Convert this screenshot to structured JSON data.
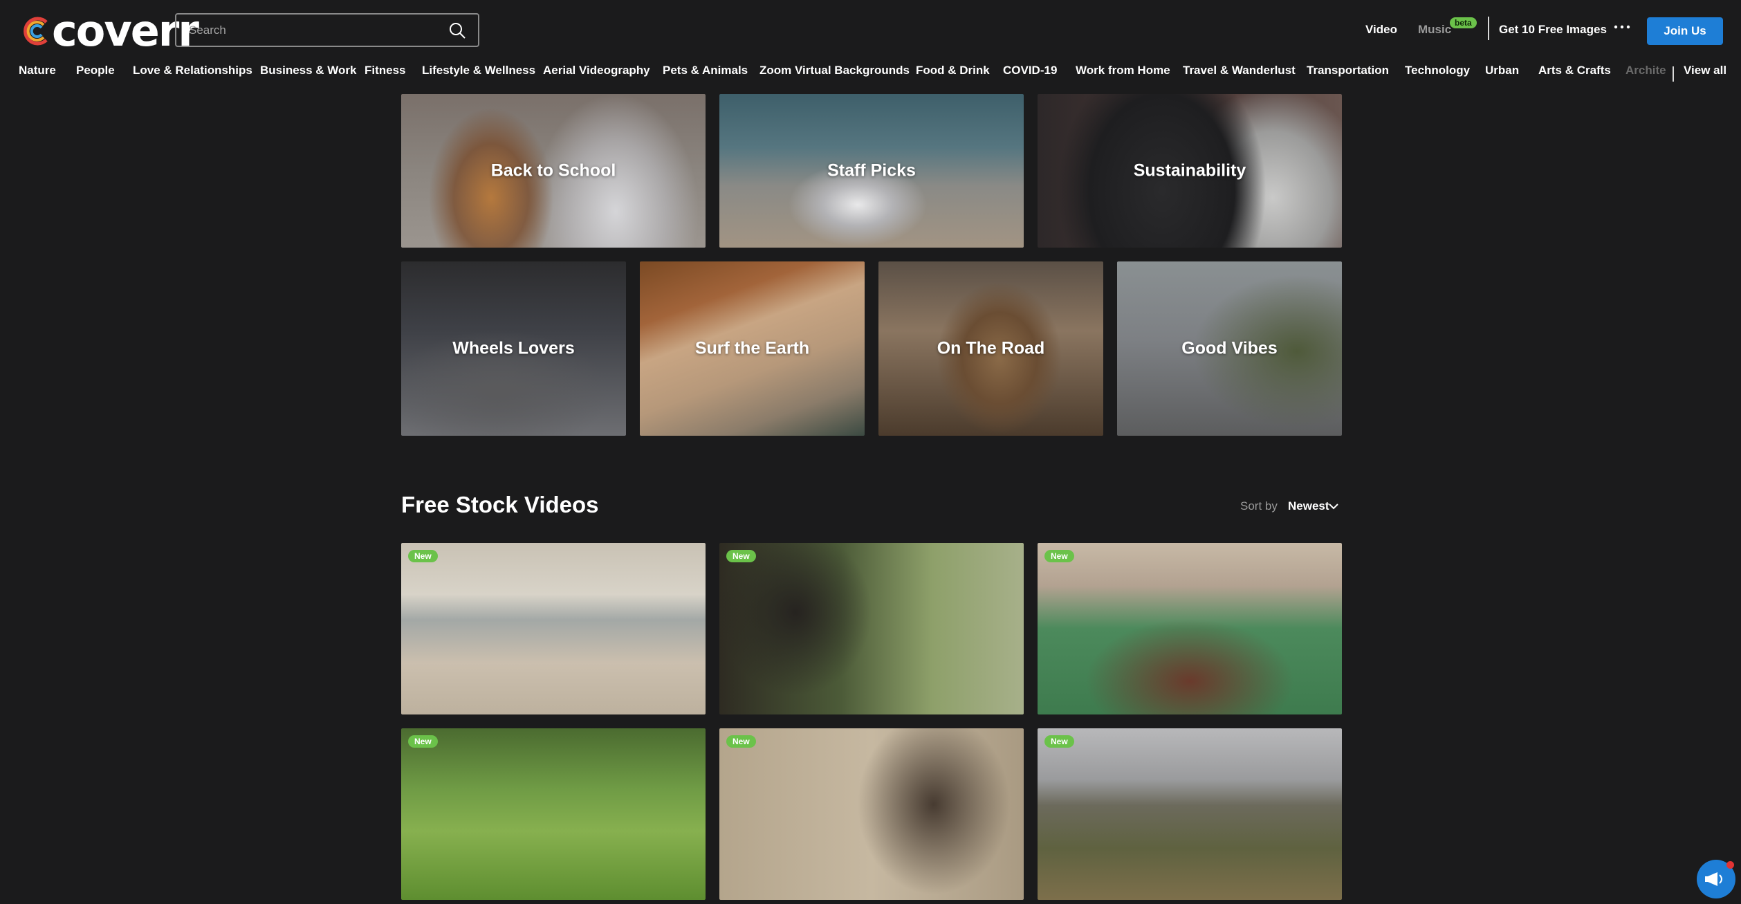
{
  "brand": {
    "name": "coverr"
  },
  "search": {
    "placeholder": "Search"
  },
  "nav": {
    "video": "Video",
    "music": "Music",
    "music_badge": "beta",
    "free_images": "Get 10 Free Images",
    "join": "Join Us"
  },
  "categories": [
    "Nature",
    "People",
    "Love & Relationships",
    "Business & Work",
    "Fitness",
    "Lifestyle & Wellness",
    "Aerial Videography",
    "Pets & Animals",
    "Zoom Virtual Backgrounds",
    "Food & Drink",
    "COVID-19",
    "Work from Home",
    "Travel & Wanderlust",
    "Transportation",
    "Technology",
    "Urban",
    "Arts & Crafts",
    "Archite"
  ],
  "view_all": "View all",
  "collections": [
    {
      "label": "Back to School"
    },
    {
      "label": "Staff Picks"
    },
    {
      "label": "Sustainability"
    },
    {
      "label": "Wheels Lovers"
    },
    {
      "label": "Surf the Earth"
    },
    {
      "label": "On The Road"
    },
    {
      "label": "Good Vibes"
    }
  ],
  "free_videos": {
    "title": "Free Stock Videos",
    "sort_label": "Sort by",
    "sort_value": "Newest",
    "badge": "New",
    "count_visible": 6
  },
  "colors": {
    "background": "#1b1b1c",
    "accent_blue": "#1e7ed6",
    "badge_green": "#6bc24a"
  }
}
